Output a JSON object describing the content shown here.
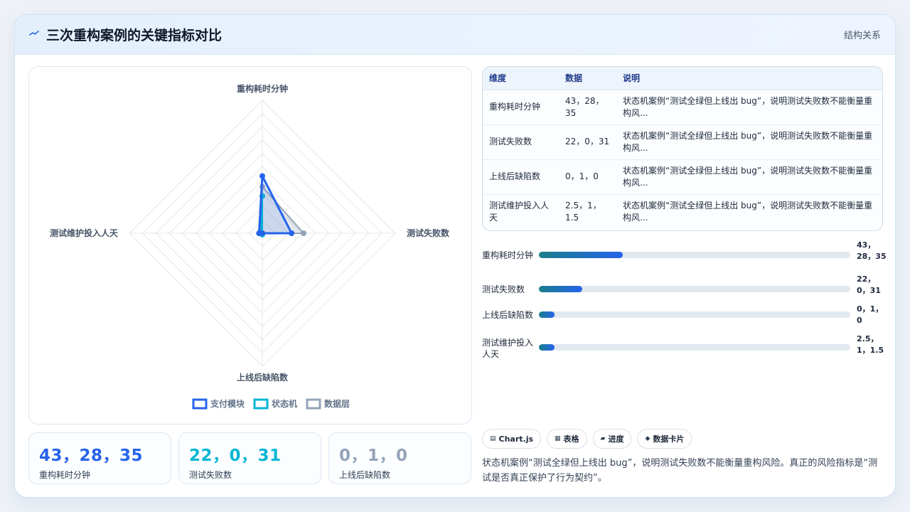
{
  "header": {
    "icon": "trend-icon",
    "title": "三次重构案例的关键指标对比",
    "tag": "结构关系"
  },
  "chart_data": {
    "type": "radar",
    "axes": [
      "重构耗时分钟",
      "测试失败数",
      "上线后缺陷数",
      "测试维护投入人天"
    ],
    "series": [
      {
        "name": "支付模块",
        "values": [
          43,
          22,
          0,
          2.5
        ],
        "color": "#2563eb"
      },
      {
        "name": "状态机",
        "values": [
          28,
          0,
          1,
          1
        ],
        "color": "#06b6d4"
      },
      {
        "name": "数据层",
        "values": [
          35,
          31,
          0,
          1.5
        ],
        "color": "#94a3b8"
      }
    ],
    "rmax": 100,
    "grid_levels": 10,
    "grid": true,
    "legend_position": "bottom"
  },
  "stats": [
    {
      "value": "43，28，35",
      "label": "重构耗时分钟",
      "color": "#2563eb"
    },
    {
      "value": "22，0，31",
      "label": "测试失败数",
      "color": "#06b6d4"
    },
    {
      "value": "0，1，0",
      "label": "上线后缺陷数",
      "color": "#94a3b8"
    }
  ],
  "table": {
    "headers": [
      "维度",
      "数据",
      "说明"
    ],
    "rows": [
      [
        "重构耗时分钟",
        "43，28，35",
        "状态机案例“测试全绿但上线出 bug”，说明测试失败数不能衡量重构风..."
      ],
      [
        "测试失败数",
        "22，0，31",
        "状态机案例“测试全绿但上线出 bug”，说明测试失败数不能衡量重构风..."
      ],
      [
        "上线后缺陷数",
        "0，1，0",
        "状态机案例“测试全绿但上线出 bug”，说明测试失败数不能衡量重构风..."
      ],
      [
        "测试维护投入人天",
        "2.5，1，1.5",
        "状态机案例“测试全绿但上线出 bug”，说明测试失败数不能衡量重构风..."
      ]
    ]
  },
  "bars": [
    {
      "label": "重构耗时分钟",
      "value_text": "43，28，35",
      "fraction": 0.27
    },
    {
      "label": "测试失败数",
      "value_text": "22，0，31",
      "fraction": 0.14
    },
    {
      "label": "上线后缺陷数",
      "value_text": "0，1，0",
      "fraction": 0.05
    },
    {
      "label": "测试维护投入人天",
      "value_text": "2.5，1，1.5",
      "fraction": 0.05
    }
  ],
  "chips": [
    {
      "icon": "chart-icon",
      "glyph": "▤",
      "label": "Chart.js"
    },
    {
      "icon": "table-icon",
      "glyph": "▦",
      "label": "表格"
    },
    {
      "icon": "progress-icon",
      "glyph": "▰",
      "label": "进度"
    },
    {
      "icon": "card-icon",
      "glyph": "◆",
      "label": "数据卡片"
    }
  ],
  "note": "状态机案例“测试全绿但上线出 bug”，说明测试失败数不能衡量重构风险。真正的风险指标是“测试是否真正保护了行为契约”。"
}
